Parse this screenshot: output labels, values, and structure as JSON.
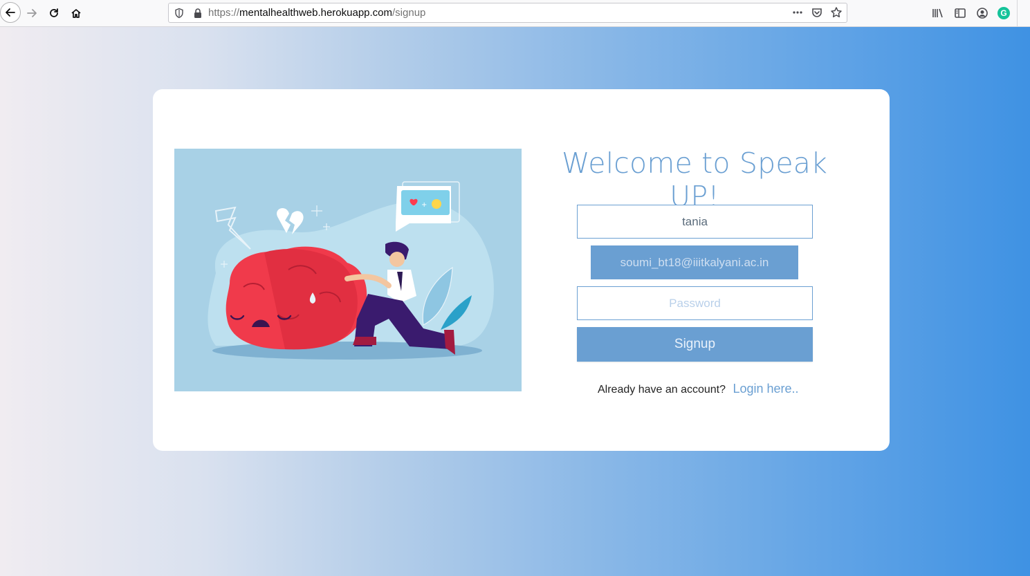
{
  "browser": {
    "url_scheme": "https://",
    "url_host": "mentalhealthweb.herokuapp.com",
    "url_path": "/signup",
    "icons": [
      "back-icon",
      "forward-icon",
      "reload-icon",
      "home-icon",
      "shield-icon",
      "lock-icon",
      "more-icon",
      "pocket-icon",
      "star-icon",
      "library-icon",
      "sidebar-icon",
      "account-icon",
      "grammarly-icon"
    ]
  },
  "signup": {
    "title": "Welcome to Speak UP!",
    "name_value": "tania",
    "email_value": "soumi_bt18@iiitkalyani.ac.in",
    "password_placeholder": "Password",
    "submit_label": "Signup",
    "already_text": "Already have an account?",
    "login_link": "Login here.."
  },
  "colors": {
    "accent": "#6a9fd2",
    "gradient_start": "#f0ecf1",
    "gradient_end": "#3f92e3",
    "illustration_bg": "#a8d1e6"
  }
}
